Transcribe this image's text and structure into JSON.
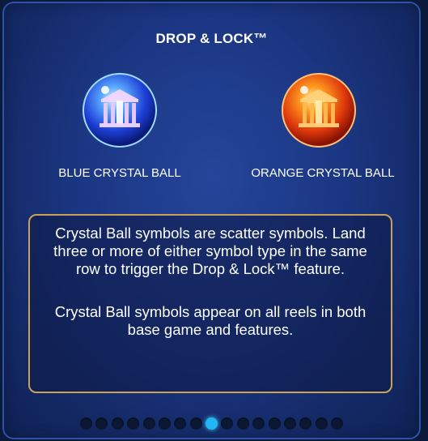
{
  "title": "DROP & LOCK™",
  "symbols": [
    {
      "label": "BLUE CRYSTAL BALL",
      "icon": "blue-crystal-ball-icon",
      "color": "#2a5bff"
    },
    {
      "label": "ORANGE CRYSTAL BALL",
      "icon": "orange-crystal-ball-icon",
      "color": "#ff5a10"
    }
  ],
  "description": {
    "paragraph_1": "Crystal Ball symbols are scatter symbols. Land three or more of either symbol type in the same row to trigger the Drop & Lock™ feature.",
    "paragraph_2": "Crystal Ball symbols appear on all reels in both base game and features."
  },
  "pagination": {
    "total_pages": 17,
    "active_page": 9
  },
  "colors": {
    "panel": "#1b3682",
    "border_accent": "#c9a159",
    "active_dot": "#21b7f4"
  }
}
